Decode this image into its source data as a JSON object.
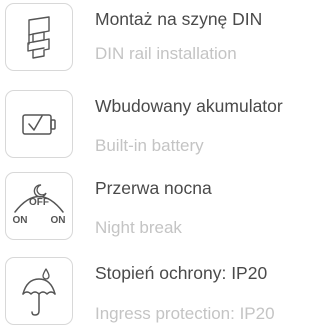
{
  "features": [
    {
      "icon": "din-rail-icon",
      "title": "Montaż na szynę DIN",
      "subtitle": "DIN rail installation"
    },
    {
      "icon": "battery-check-icon",
      "title": "Wbudowany akumulator",
      "subtitle": "Built-in battery"
    },
    {
      "icon": "night-break-icon",
      "title": "Przerwa nocna",
      "subtitle": "Night break",
      "icon_labels": {
        "off": "OFF",
        "on_left": "ON",
        "on_right": "ON"
      }
    },
    {
      "icon": "umbrella-icon",
      "title": "Stopień ochrony: IP20",
      "subtitle": "Ingress protection: IP20"
    }
  ],
  "colors": {
    "title": "#4a4a4a",
    "subtitle": "#c4c4c4",
    "icon_stroke": "#555555",
    "icon_border": "#d8d8d8"
  }
}
